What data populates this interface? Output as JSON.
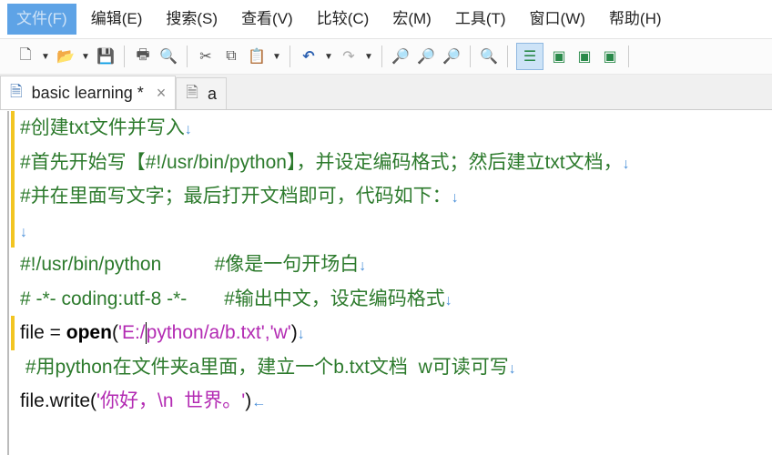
{
  "menu": [
    "文件(F)",
    "编辑(E)",
    "搜索(S)",
    "查看(V)",
    "比较(C)",
    "宏(M)",
    "工具(T)",
    "窗口(W)",
    "帮助(H)"
  ],
  "tabs": [
    {
      "label": "basic learning *",
      "close": "×",
      "icon": "python-file-icon"
    },
    {
      "label": "a",
      "icon": "text-file-icon"
    }
  ],
  "colors": {
    "comment": "#2c7a2c",
    "string": "#b32bb3",
    "eol": "#4a90d9",
    "change_marker": "#f2c522"
  },
  "lines": [
    {
      "mod": true,
      "segs": [
        {
          "t": "#创建txt文件并写入",
          "c": "c"
        },
        {
          "t": "↓",
          "c": "e"
        }
      ]
    },
    {
      "mod": true,
      "segs": [
        {
          "t": "#首先开始写【#!/usr/bin/python】，并设定编码格式；然后建立txt文档，",
          "c": "c"
        },
        {
          "t": "↓",
          "c": "e"
        }
      ]
    },
    {
      "mod": true,
      "segs": [
        {
          "t": "#并在里面写文字；最后打开文档即可，代码如下：",
          "c": "c"
        },
        {
          "t": "↓",
          "c": "e"
        }
      ]
    },
    {
      "mod": true,
      "segs": [
        {
          "t": "↓",
          "c": "e"
        }
      ]
    },
    {
      "mod": false,
      "segs": [
        {
          "t": "#!/usr/bin/python          #像是一句开场白",
          "c": "c"
        },
        {
          "t": "↓",
          "c": "e"
        }
      ]
    },
    {
      "mod": false,
      "segs": [
        {
          "t": "# -*- coding:utf-8 -*-       #输出中文，设定编码格式",
          "c": "c"
        },
        {
          "t": "↓",
          "c": "e"
        }
      ]
    },
    {
      "mod": true,
      "segs": [
        {
          "t": "file = ",
          "c": "n"
        },
        {
          "t": "open",
          "c": "k"
        },
        {
          "t": "(",
          "c": "n"
        },
        {
          "t": "'E:/",
          "c": "s"
        },
        {
          "t": "",
          "c": "caret"
        },
        {
          "t": "python/a/b.txt','w'",
          "c": "s"
        },
        {
          "t": ")",
          "c": "n"
        },
        {
          "t": "↓",
          "c": "e"
        }
      ]
    },
    {
      "mod": false,
      "segs": [
        {
          "t": " #用python在文件夹a里面，建立一个b.txt文档  w可读可写",
          "c": "c"
        },
        {
          "t": "↓",
          "c": "e"
        }
      ]
    },
    {
      "mod": false,
      "segs": [
        {
          "t": "file.write(",
          "c": "n"
        },
        {
          "t": "'你好，\\n  世界。'",
          "c": "s"
        },
        {
          "t": ")",
          "c": "n"
        },
        {
          "t": "←",
          "c": "e"
        }
      ]
    }
  ]
}
